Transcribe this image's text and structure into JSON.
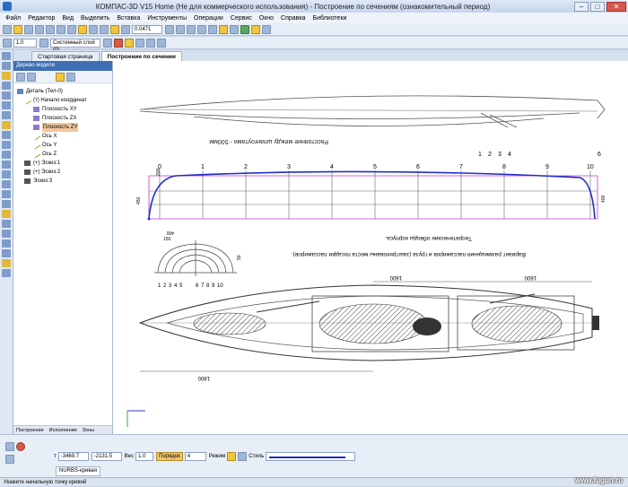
{
  "window": {
    "title": "КОМПАС-3D V15 Home (Не для коммерческого использования) - Построение по сечениям (ознакомительный период)",
    "min_label": "–",
    "max_label": "□",
    "close_label": "✕"
  },
  "menu": [
    "Файл",
    "Редактор",
    "Вид",
    "Выделить",
    "Вставка",
    "Инструменты",
    "Операции",
    "Сервис",
    "Окно",
    "Справка",
    "Библиотеки"
  ],
  "toolbar": {
    "zoom_value": "0.0471",
    "scale_value": "1.0",
    "layer_value": "Системный слой (0)"
  },
  "tabs": [
    {
      "label": "Стартовая страница"
    },
    {
      "label": "Построение по сечении"
    }
  ],
  "tree_panel": {
    "title": "Дерево модели",
    "nodes": [
      {
        "label": "Деталь (Тел-0)",
        "icon": "part-icon"
      },
      {
        "label": "(т) Начало координат",
        "icon": "origin-icon"
      },
      {
        "label": "Плоскость XY",
        "icon": "plane-icon"
      },
      {
        "label": "Плоскость ZX",
        "icon": "plane-icon"
      },
      {
        "label": "Плоскость ZY",
        "icon": "plane-icon"
      },
      {
        "label": "Ось X",
        "icon": "axis-icon"
      },
      {
        "label": "Ось Y",
        "icon": "axis-icon"
      },
      {
        "label": "Ось Z",
        "icon": "axis-icon"
      },
      {
        "label": "(+) Эскиз:1",
        "icon": "sketch-icon"
      },
      {
        "label": "(+) Эскиз:2",
        "icon": "sketch-icon"
      },
      {
        "label": "Эскиз:3",
        "icon": "sketch-icon"
      }
    ],
    "bottom_tabs": [
      "Построение",
      "Исполнения",
      "Зоны"
    ]
  },
  "drawing": {
    "station_labels": [
      "0",
      "1",
      "2",
      "3",
      "4",
      "5",
      "6",
      "7",
      "8",
      "9",
      "10"
    ],
    "top_text": "Расстояние между шпангоутами - 500мм",
    "section_text": "Теоретические обводы корпуса.",
    "plan_text": "Вариант размещения пассажиров и груза (заштрихованы места посадки пассажиров).",
    "dims": [
      "1800",
      "1600",
      "1600",
      "200",
      "400",
      "400",
      "150",
      "450",
      "50"
    ],
    "tail_numbers": [
      "1",
      "2",
      "3",
      "4"
    ],
    "body_numbers": [
      "6",
      "7",
      "8",
      "9",
      "10"
    ],
    "small_numbers": [
      "1",
      "2",
      "3",
      "4",
      "5"
    ],
    "colors": {
      "blue_curve": "#1f2dc8",
      "magenta_box": "#cc33cc"
    }
  },
  "properties": {
    "x_value": "-3469.7",
    "y_value": "-2131.5",
    "weight_label": "Вес",
    "weight_value": "1.0",
    "order_label": "Порядок",
    "order_value": "4",
    "mode_label": "Режим",
    "style_label": "Стиль",
    "tab_label": "NURBS-кривая"
  },
  "status": {
    "text": "Укажите начальную точку кривой"
  },
  "watermark": "www.fugun.ru"
}
